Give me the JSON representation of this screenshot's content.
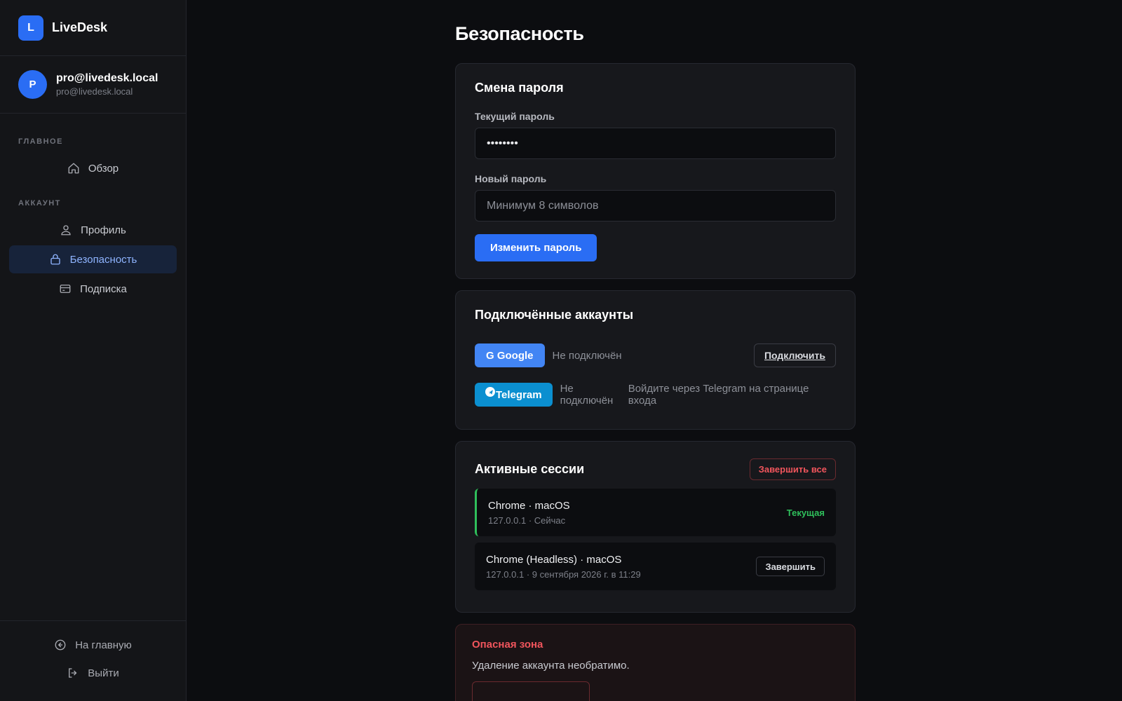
{
  "app": {
    "logo_letter": "L",
    "name": "LiveDesk"
  },
  "user": {
    "avatar_letter": "P",
    "name": "pro@livedesk.local",
    "email": "pro@livedesk.local"
  },
  "sidebar": {
    "sections": [
      {
        "heading": "ГЛАВНОЕ",
        "items": [
          {
            "label": "Обзор",
            "icon": "home-icon"
          }
        ]
      },
      {
        "heading": "АККАУНТ",
        "items": [
          {
            "label": "Профиль",
            "icon": "user-icon"
          },
          {
            "label": "Безопасность",
            "icon": "lock-icon",
            "active": true
          },
          {
            "label": "Подписка",
            "icon": "card-icon"
          }
        ]
      }
    ],
    "bottom": [
      {
        "label": "На главную",
        "icon": "arrow-left-circle-icon"
      },
      {
        "label": "Выйти",
        "icon": "logout-icon"
      }
    ]
  },
  "page": {
    "title": "Безопасность"
  },
  "password_card": {
    "title": "Смена пароля",
    "current_label": "Текущий пароль",
    "current_value": "••••••••",
    "new_label": "Новый пароль",
    "new_placeholder": "Минимум 8 символов",
    "submit_label": "Изменить пароль"
  },
  "accounts_card": {
    "title": "Подключённые аккаунты",
    "google": {
      "badge": "G Google",
      "status": "Не подключён",
      "action": "Подключить"
    },
    "telegram": {
      "badge": "Telegram",
      "status": "Не подключён",
      "hint": "Войдите через Telegram на странице входа"
    }
  },
  "sessions_card": {
    "title": "Активные сессии",
    "end_all_label": "Завершить все",
    "sessions": [
      {
        "name": "Chrome · macOS",
        "meta": "127.0.0.1 · Сейчас",
        "current_label": "Текущая"
      },
      {
        "name": "Chrome (Headless) · macOS",
        "meta": "127.0.0.1 · 9 сентября 2026 г. в 11:29",
        "action": "Завершить"
      }
    ]
  },
  "danger_card": {
    "title": "Опасная зона",
    "text": "Удаление аккаунта необратимо."
  },
  "colors": {
    "accent": "#2a6df4",
    "success": "#2fbf5b",
    "danger": "#f0555c",
    "google": "#4285f4",
    "telegram": "#0b8fd0"
  }
}
